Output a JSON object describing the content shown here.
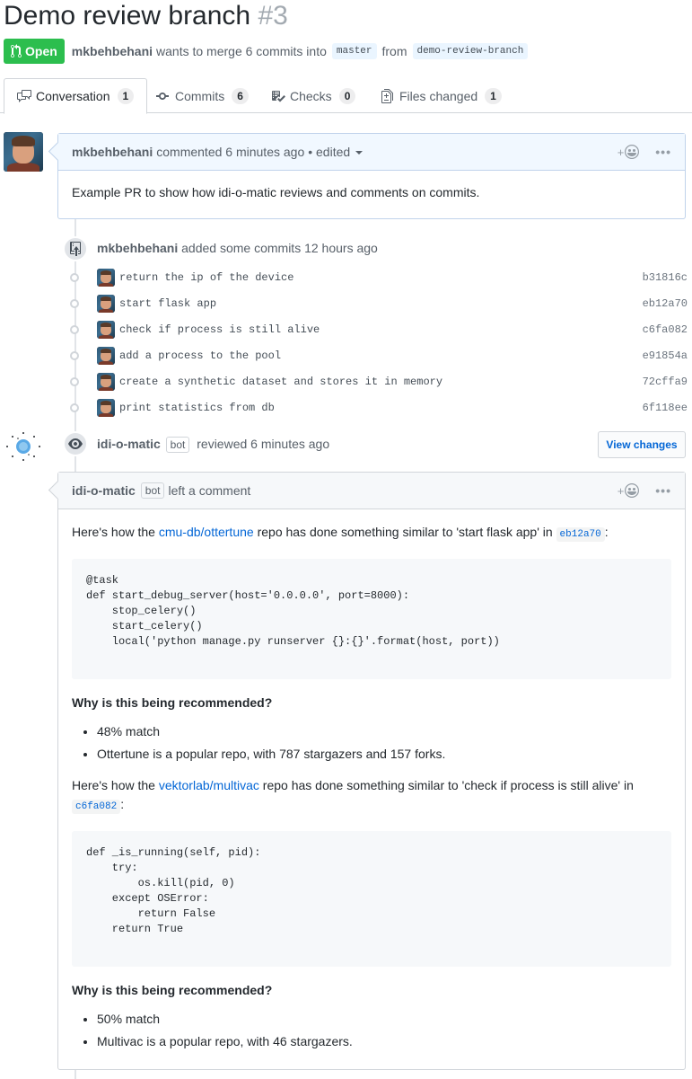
{
  "header": {
    "title": "Demo review branch",
    "number": "#3",
    "state": "Open",
    "author": "mkbehbehani",
    "merge_text_1": "wants to merge 6 commits into",
    "base_branch": "master",
    "merge_text_2": "from",
    "head_branch": "demo-review-branch"
  },
  "tabs": [
    {
      "label": "Conversation",
      "count": "1",
      "icon": "comment-discussion-icon"
    },
    {
      "label": "Commits",
      "count": "6",
      "icon": "git-commit-icon"
    },
    {
      "label": "Checks",
      "count": "0",
      "icon": "checklist-icon"
    },
    {
      "label": "Files changed",
      "count": "1",
      "icon": "diff-icon"
    }
  ],
  "first_comment": {
    "author": "mkbehbehani",
    "action": "commented 6 minutes ago",
    "edited": "• edited",
    "body": "Example PR to show how idi-o-matic reviews and comments on commits."
  },
  "commits_event": {
    "author": "mkbehbehani",
    "action": "added some commits 12 hours ago",
    "commits": [
      {
        "message": "return the ip of the device",
        "sha": "b31816c"
      },
      {
        "message": "start flask app",
        "sha": "eb12a70"
      },
      {
        "message": "check if process is still alive",
        "sha": "c6fa082"
      },
      {
        "message": "add a process to the pool",
        "sha": "e91854a"
      },
      {
        "message": "create a synthetic dataset and stores it in memory",
        "sha": "72cffa9"
      },
      {
        "message": "print statistics from db",
        "sha": "6f118ee"
      }
    ]
  },
  "review_event": {
    "author": "idi-o-matic",
    "bot_label": "bot",
    "action": "reviewed 6 minutes ago",
    "button": "View changes"
  },
  "review_comment": {
    "author": "idi-o-matic",
    "bot_label": "bot",
    "action": "left a comment",
    "sections": [
      {
        "intro_1": "Here's how the",
        "repo": "cmu-db/ottertune",
        "intro_2": "repo has done something similar to 'start flask app' in",
        "sha": "eb12a70",
        "intro_3": ":",
        "code": "@task\ndef start_debug_server(host='0.0.0.0', port=8000):\n    stop_celery()\n    start_celery()\n    local('python manage.py runserver {}:{}'.format(host, port))",
        "why": "Why is this being recommended?",
        "bullets": [
          "48% match",
          "Ottertune is a popular repo, with 787 stargazers and 157 forks."
        ]
      },
      {
        "intro_1": "Here's how the",
        "repo": "vektorlab/multivac",
        "intro_2": "repo has done something similar to 'check if process is still alive' in",
        "sha": "c6fa082",
        "intro_3": ":",
        "code": "def _is_running(self, pid):\n    try:\n        os.kill(pid, 0)\n    except OSError:\n        return False\n    return True",
        "why": "Why is this being recommended?",
        "bullets": [
          "50% match",
          "Multivac is a popular repo, with 46 stargazers."
        ]
      }
    ]
  },
  "colors": {
    "open_green": "#2cbe4e",
    "link_blue": "#0366d6",
    "header_blue_bg": "#f1f8ff"
  }
}
